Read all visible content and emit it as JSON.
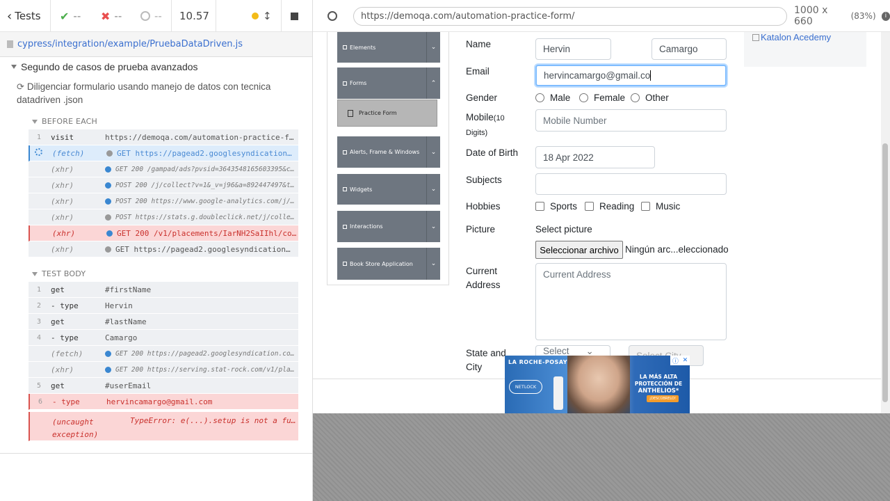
{
  "reporter": {
    "back_label": "Tests",
    "passed": "--",
    "failed": "--",
    "pending": "--",
    "duration": "10.57",
    "spec_path": "cypress/integration/example/PruebaDataDriven.js",
    "suite_title": "Segundo de casos de prueba avanzados",
    "test_title": "Diligenciar formulario usando manejo de datos con tecnica datadriven .json",
    "before_each_label": "BEFORE EACH",
    "test_body_label": "TEST BODY",
    "before_each": [
      {
        "num": "1",
        "name": "visit",
        "msg": "https://demoqa.com/automation-practice-f…",
        "state": "normal",
        "dot": ""
      },
      {
        "num": "",
        "name": "(fetch)",
        "msg": "GET https://pagead2.googlesyndication…",
        "state": "blue",
        "dot": "#999"
      },
      {
        "num": "",
        "name": "(xhr)",
        "msg": "GET 200 /gampad/ads?pvsid=3643548165603395&c…",
        "state": "small",
        "dot": "#3a87d1"
      },
      {
        "num": "",
        "name": "(xhr)",
        "msg": "POST 200 /j/collect?v=1&_v=j96&a=892447497&t…",
        "state": "small",
        "dot": "#3a87d1"
      },
      {
        "num": "",
        "name": "(xhr)",
        "msg": "POST 200 https://www.google-analytics.com/j/…",
        "state": "small",
        "dot": "#3a87d1"
      },
      {
        "num": "",
        "name": "(xhr)",
        "msg": "POST https://stats.g.doubleclick.net/j/colle…",
        "state": "small",
        "dot": "#999"
      },
      {
        "num": "",
        "name": "(xhr)",
        "msg": "GET 200 /v1/placements/IarNH2SaIIhl/code/js/…",
        "state": "red",
        "dot": "#3a87d1"
      },
      {
        "num": "",
        "name": "(xhr)",
        "msg": "GET https://pagead2.googlesyndication…",
        "state": "normal",
        "dot": "#999"
      }
    ],
    "test_body": [
      {
        "num": "1",
        "name": "get",
        "msg": "#firstName",
        "state": "normal",
        "dot": ""
      },
      {
        "num": "2",
        "name": " - type",
        "msg": "Hervin",
        "state": "normal",
        "dot": ""
      },
      {
        "num": "3",
        "name": "get",
        "msg": "#lastName",
        "state": "normal",
        "dot": ""
      },
      {
        "num": "4",
        "name": " - type",
        "msg": "Camargo",
        "state": "normal",
        "dot": ""
      },
      {
        "num": "",
        "name": "(fetch)",
        "msg": "GET 200 https://pagead2.googlesyndication.co…",
        "state": "small",
        "dot": "#3a87d1"
      },
      {
        "num": "",
        "name": "(xhr)",
        "msg": "GET 200 https://serving.stat-rock.com/v1/pla…",
        "state": "small",
        "dot": "#3a87d1"
      },
      {
        "num": "5",
        "name": "get",
        "msg": "#userEmail",
        "state": "normal",
        "dot": ""
      },
      {
        "num": "6",
        "name": " - type",
        "msg": "hervincamargo@gmail.com",
        "state": "red",
        "dot": ""
      }
    ],
    "error_name": "(uncaught exception)",
    "error_msg": "TypeError: e(...).setup is not a fu…"
  },
  "browser": {
    "url": "https://demoqa.com/automation-practice-form/",
    "viewport": "1000 x 660",
    "zoom": "(83%)"
  },
  "sidebar": {
    "groups": [
      "Elements",
      "Forms",
      "Alerts, Frame & Windows",
      "Widgets",
      "Interactions",
      "Book Store Application"
    ],
    "active_item": "Practice Form"
  },
  "form": {
    "name_label": "Name",
    "first_name": "Hervin",
    "last_name": "Camargo",
    "email_label": "Email",
    "email_value": "hervincamargo@gmail.co",
    "gender_label": "Gender",
    "genders": [
      "Male",
      "Female",
      "Other"
    ],
    "mobile_label": "Mobile",
    "mobile_sub1": "(10",
    "mobile_sub2": "Digits)",
    "mobile_placeholder": "Mobile Number",
    "dob_label": "Date of Birth",
    "dob_value": "18 Apr 2022",
    "subjects_label": "Subjects",
    "hobbies_label": "Hobbies",
    "hobbies": [
      "Sports",
      "Reading",
      "Music"
    ],
    "picture_label": "Picture",
    "select_picture": "Select picture",
    "file_button": "Seleccionar archivo",
    "file_status": "Ningún arc...eleccionado",
    "address_label_1": "Current",
    "address_label_2": "Address",
    "address_placeholder": "Current Address",
    "state_label_1": "State and",
    "state_label_2": "City",
    "state_placeholder": "Select",
    "city_placeholder": "Select City"
  },
  "katalon_alt": "Katalon Acedemy",
  "ad": {
    "brand": "LA ROCHE-POSAY",
    "badge": "NETLOCK",
    "headline_1": "LA MÁS ALTA",
    "headline_2": "PROTECCIÓN DE",
    "headline_3": "ANTHELIOS*",
    "cta": "¡DESCÚBRELO!"
  },
  "colors": {
    "passed": "#4cae4c",
    "failed": "#e94f4f",
    "running_blue": "#3a87d1",
    "error_red": "#c9302c",
    "spec_link": "#3a6fcf",
    "running_dot": "#f3bb18"
  }
}
